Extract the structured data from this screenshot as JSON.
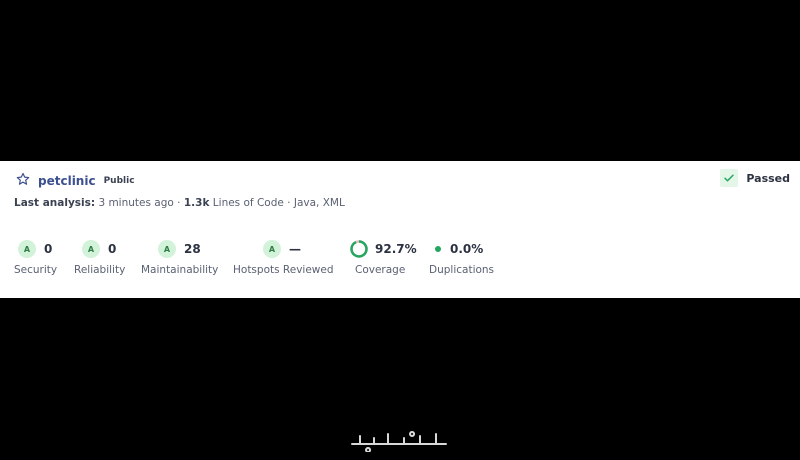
{
  "project": {
    "name": "petclinic",
    "visibility": "Public",
    "star_icon": "star-icon"
  },
  "quality_gate": {
    "status": "Passed",
    "icon": "check-icon",
    "color": "#23a660"
  },
  "analysis": {
    "label": "Last analysis:",
    "time": "3 minutes ago",
    "sep1": "·",
    "loc_value": "1.3k",
    "loc_label": "Lines of Code",
    "sep2": "·",
    "languages": "Java, XML"
  },
  "metrics": {
    "security": {
      "rating": "A",
      "value": "0",
      "label": "Security"
    },
    "reliability": {
      "rating": "A",
      "value": "0",
      "label": "Reliability"
    },
    "maintainability": {
      "rating": "A",
      "value": "28",
      "label": "Maintainability"
    },
    "hotspots": {
      "rating": "A",
      "value": "—",
      "label": "Hotspots Reviewed"
    },
    "coverage": {
      "value": "92.7%",
      "label": "Coverage",
      "percent": 92.7
    },
    "duplications": {
      "value": "0.0%",
      "label": "Duplications"
    }
  },
  "watermark": {
    "text": "خمسات"
  }
}
